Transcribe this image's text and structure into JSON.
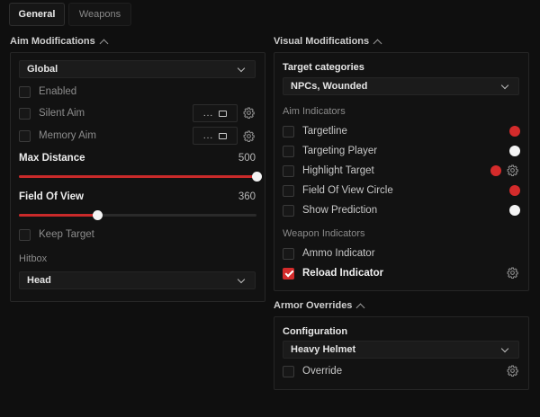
{
  "tabs": [
    {
      "label": "General",
      "active": true
    },
    {
      "label": "Weapons",
      "active": false
    }
  ],
  "aim": {
    "title": "Aim Modifications",
    "mode_select": "Global",
    "enabled_label": "Enabled",
    "silent_aim_label": "Silent Aim",
    "silent_aim_key": "...",
    "memory_aim_label": "Memory Aim",
    "memory_aim_key": "...",
    "max_distance_label": "Max Distance",
    "max_distance_value": "500",
    "max_distance_fraction": 1.0,
    "fov_label": "Field Of View",
    "fov_value": "360",
    "fov_fraction": 0.33,
    "keep_target_label": "Keep Target",
    "hitbox_label": "Hitbox",
    "hitbox_select": "Head"
  },
  "visual": {
    "title": "Visual Modifications",
    "target_categories_label": "Target categories",
    "target_categories_select": "NPCs, Wounded",
    "aim_indicators_label": "Aim Indicators",
    "targetline_label": "Targetline",
    "targeting_player_label": "Targeting Player",
    "highlight_target_label": "Highlight Target",
    "fov_circle_label": "Field Of View Circle",
    "show_prediction_label": "Show Prediction",
    "weapon_indicators_label": "Weapon Indicators",
    "ammo_indicator_label": "Ammo Indicator",
    "reload_indicator_label": "Reload Indicator",
    "colors": {
      "red": "#d42b2b",
      "white": "#f4f4f4"
    }
  },
  "armor": {
    "title": "Armor Overrides",
    "configuration_label": "Configuration",
    "configuration_select": "Heavy Helmet",
    "override_label": "Override"
  }
}
